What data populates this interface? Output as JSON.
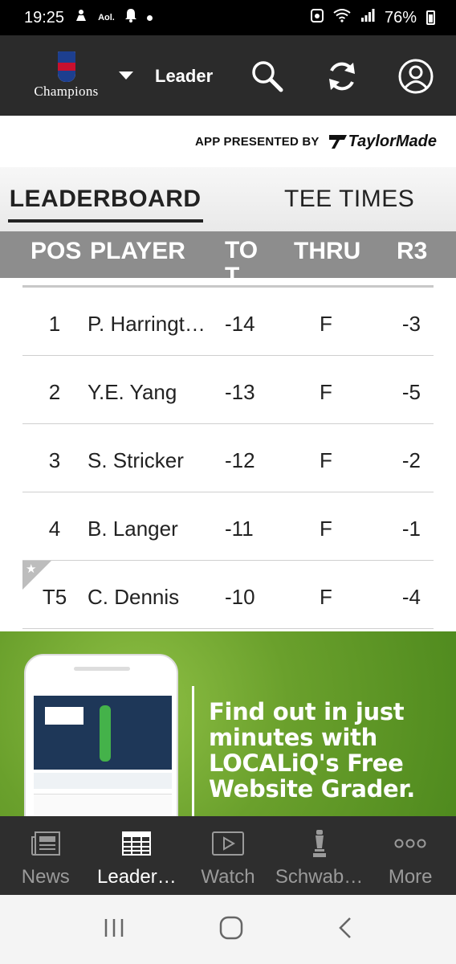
{
  "status_bar": {
    "time": "19:25",
    "carrier": "Aol.",
    "battery": "76%"
  },
  "header": {
    "logo_text": "Champions",
    "logo_badge": "PGA TOUR",
    "title": "Leader"
  },
  "sponsor": {
    "label": "APP PRESENTED BY",
    "brand": "TaylorMade"
  },
  "tabs": [
    {
      "label": "LEADERBOARD",
      "active": true
    },
    {
      "label": "TEE TIMES",
      "active": false
    }
  ],
  "columns": {
    "pos": "POS",
    "player": "PLAYER",
    "tot": "TOT",
    "thru": "THRU",
    "r3": "R3"
  },
  "rows": [
    {
      "pos": "1",
      "player": "P. Harringt…",
      "tot": "-14",
      "thru": "F",
      "r3": "-3"
    },
    {
      "pos": "2",
      "player": "Y.E. Yang",
      "tot": "-13",
      "thru": "F",
      "r3": "-5"
    },
    {
      "pos": "3",
      "player": "S. Stricker",
      "tot": "-12",
      "thru": "F",
      "r3": "-2"
    },
    {
      "pos": "4",
      "player": "B. Langer",
      "tot": "-11",
      "thru": "F",
      "r3": "-1"
    },
    {
      "pos": "T5",
      "player": "C. Dennis",
      "tot": "-10",
      "thru": "F",
      "r3": "-4",
      "starred": true
    }
  ],
  "ad": {
    "headline": "Find out in just minutes with LOCALiQ's Free Website Grader."
  },
  "bottom_nav": [
    {
      "label": "News",
      "icon": "newspaper-icon",
      "active": false
    },
    {
      "label": "Leader…",
      "icon": "leaderboard-grid-icon",
      "active": true
    },
    {
      "label": "Watch",
      "icon": "play-video-icon",
      "active": false
    },
    {
      "label": "Schwab…",
      "icon": "trophy-icon",
      "active": false
    },
    {
      "label": "More",
      "icon": "more-dots-icon",
      "active": false
    }
  ],
  "colors": {
    "header_bg": "#2b2b2b",
    "column_header_bg": "#8d8d8d",
    "nav_bg": "#2e2e2e",
    "ad_green": "#6aa02c"
  }
}
